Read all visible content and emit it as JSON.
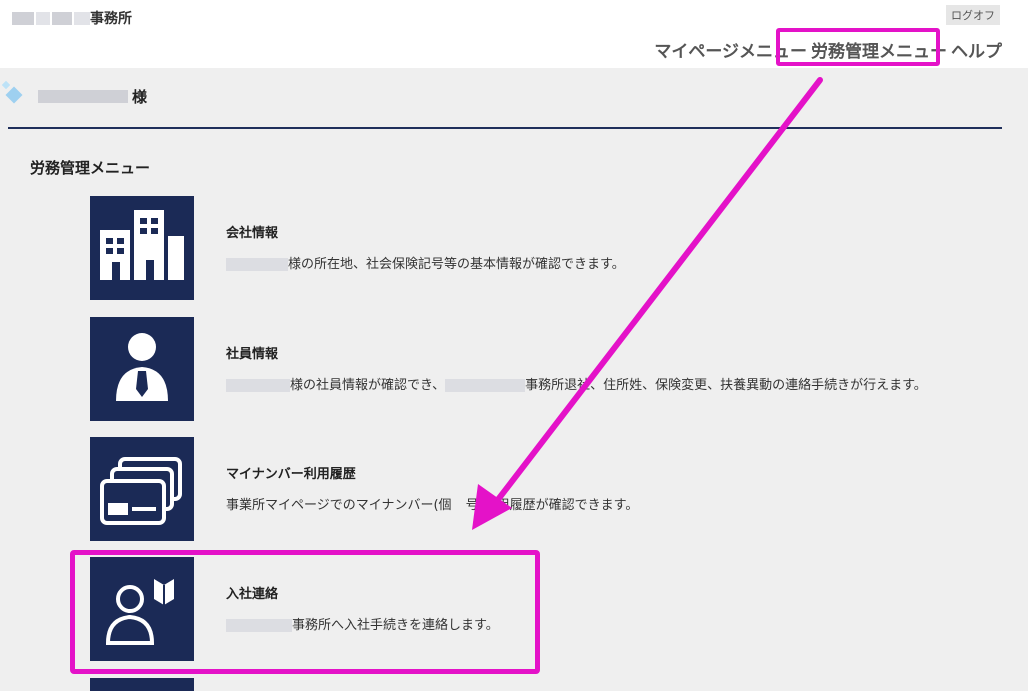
{
  "header": {
    "office_name": "事務所",
    "logoff_label": "ログオフ",
    "nav": [
      {
        "label": "マイページメニュー"
      },
      {
        "label": "労務管理メニュー"
      },
      {
        "label": "ヘルプ"
      }
    ]
  },
  "user": {
    "honorific": "様"
  },
  "section_title": "労務管理メニュー",
  "menu": [
    {
      "title": "会社情報",
      "desc_after": "様の所在地、社会保険記号等の基本情報が確認できます。"
    },
    {
      "title": "社員情報",
      "desc_mid": "様の社員情報が確認でき、",
      "desc_after": "事務所",
      "desc_tail": "退社、住所姓、保険変更、扶養異動の連絡手続きが行えます。"
    },
    {
      "title": "マイナンバー利用履歴",
      "desc_before": "事業所マイページでのマイナンバー(個",
      "desc_after": "号)利用履歴が確認できます。"
    },
    {
      "title": "入社連絡",
      "desc_after": "事務所へ入社手続きを連絡します。"
    }
  ],
  "colors": {
    "tile_bg": "#1b2a56",
    "highlight": "#e412c8",
    "accent_rule": "#1f2f5b"
  },
  "icons": [
    "building-icon",
    "person-tie-icon",
    "cards-icon",
    "new-employee-icon"
  ]
}
